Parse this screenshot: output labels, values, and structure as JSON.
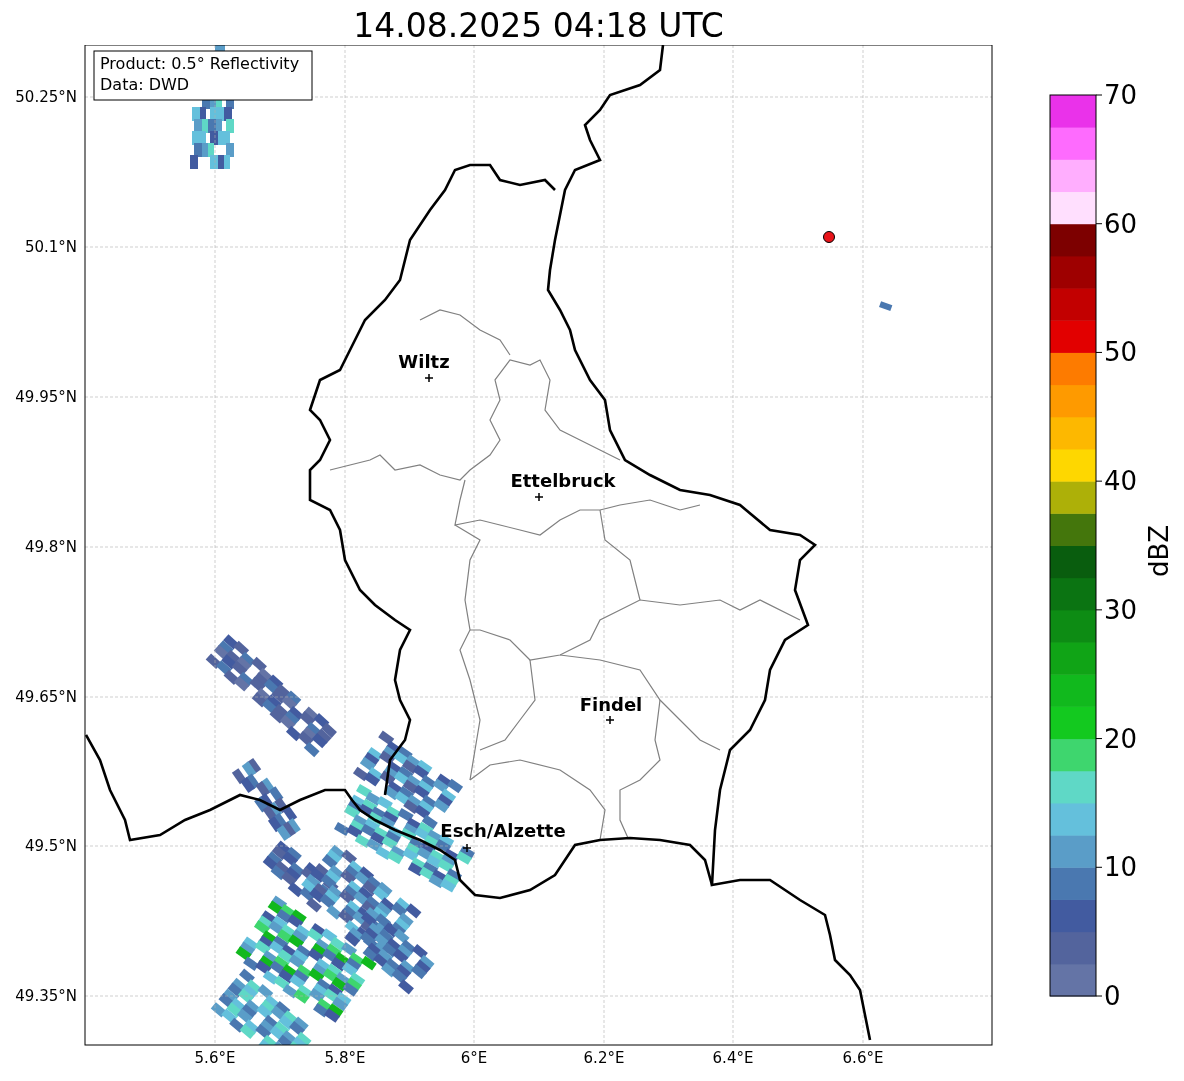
{
  "title": "14.08.2025 04:18 UTC",
  "info_box": [
    "Product: 0.5° Reflectivity",
    "Data: DWD"
  ],
  "lat_ticks": [
    "50.25°N",
    "50.1°N",
    "49.95°N",
    "49.8°N",
    "49.65°N",
    "49.5°N",
    "49.35°N"
  ],
  "lon_ticks": [
    "5.6°E",
    "5.8°E",
    "6°E",
    "6.2°E",
    "6.4°E",
    "6.6°E"
  ],
  "cities": [
    {
      "name": "Wiltz"
    },
    {
      "name": "Ettelbruck"
    },
    {
      "name": "Findel"
    },
    {
      "name": "Esch/Alzette"
    }
  ],
  "colorbar": {
    "label": "dBZ",
    "ticks": [
      "70",
      "60",
      "50",
      "40",
      "30",
      "20",
      "10",
      "0"
    ],
    "bins": [
      {
        "color": "#6474a6"
      },
      {
        "color": "#53649d"
      },
      {
        "color": "#425ba0"
      },
      {
        "color": "#4a78b0"
      },
      {
        "color": "#5a9dc8"
      },
      {
        "color": "#64c0dc"
      },
      {
        "color": "#5fd8c6"
      },
      {
        "color": "#3ed66e"
      },
      {
        "color": "#13c91f"
      },
      {
        "color": "#11b91d"
      },
      {
        "color": "#10a416"
      },
      {
        "color": "#0d8c14"
      },
      {
        "color": "#0b7412"
      },
      {
        "color": "#095d0e"
      },
      {
        "color": "#44760c"
      },
      {
        "color": "#adb008"
      },
      {
        "color": "#fed700"
      },
      {
        "color": "#fdb800"
      },
      {
        "color": "#fe9a00"
      },
      {
        "color": "#fd7b00"
      },
      {
        "color": "#e20000"
      },
      {
        "color": "#c20000"
      },
      {
        "color": "#9e0000"
      },
      {
        "color": "#7d0000"
      },
      {
        "color": "#ffdffe"
      },
      {
        "color": "#ffaefe"
      },
      {
        "color": "#fe6bfe"
      },
      {
        "color": "#ea32ea"
      }
    ]
  }
}
